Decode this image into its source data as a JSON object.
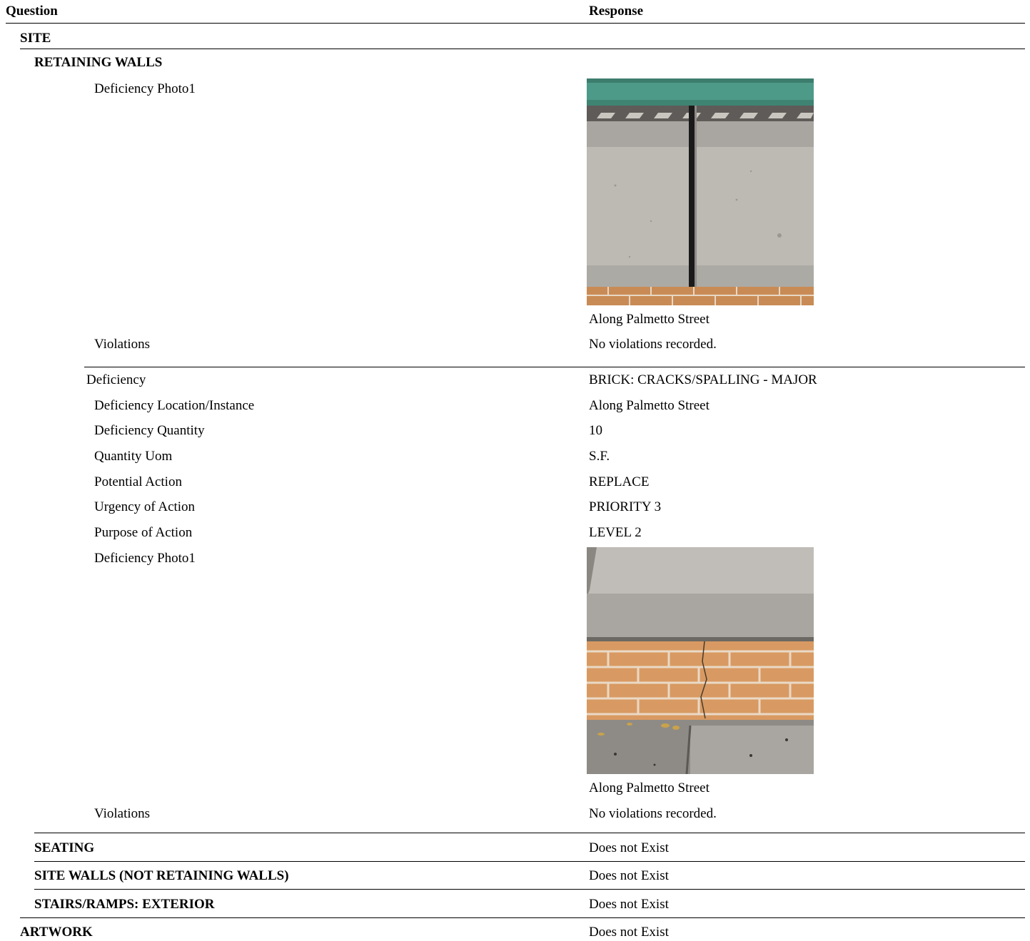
{
  "header": {
    "question": "Question",
    "response": "Response"
  },
  "sections": {
    "site": "SITE",
    "retaining_walls": "RETAINING WALLS",
    "seating": {
      "label": "SEATING",
      "response": "Does not Exist"
    },
    "site_walls": {
      "label": "SITE WALLS (NOT RETAINING WALLS)",
      "response": "Does not Exist"
    },
    "stairs": {
      "label": "STAIRS/RAMPS: EXTERIOR",
      "response": "Does not Exist"
    },
    "artwork": {
      "label": "ARTWORK",
      "response": "Does not Exist"
    }
  },
  "block1": {
    "photo_label": "Deficiency Photo1",
    "photo_caption": "Along Palmetto Street",
    "violations_label": "Violations",
    "violations_value": "No violations recorded."
  },
  "block2": {
    "deficiency_label": "Deficiency",
    "deficiency_value": "BRICK: CRACKS/SPALLING - MAJOR",
    "location_label": "Deficiency Location/Instance",
    "location_value": "Along Palmetto Street",
    "quantity_label": "Deficiency Quantity",
    "quantity_value": "10",
    "uom_label": "Quantity Uom",
    "uom_value": "S.F.",
    "action_label": "Potential Action",
    "action_value": "REPLACE",
    "urgency_label": "Urgency of Action",
    "urgency_value": "PRIORITY 3",
    "purpose_label": "Purpose of Action",
    "purpose_value": "LEVEL 2",
    "photo_label": "Deficiency Photo1",
    "photo_caption": "Along Palmetto Street",
    "violations_label": "Violations",
    "violations_value": "No violations recorded."
  }
}
